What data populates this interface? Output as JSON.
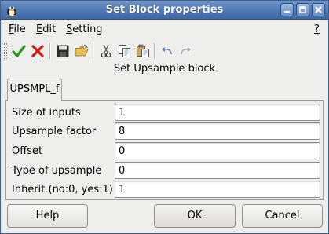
{
  "window": {
    "title": "Set Block properties",
    "controls": [
      "minimize-icon",
      "maximize-icon",
      "close-icon"
    ]
  },
  "menubar": {
    "file": {
      "underline": "F",
      "rest": "ile"
    },
    "edit": {
      "underline": "E",
      "rest": "dit"
    },
    "setting": {
      "underline": "S",
      "rest": "etting"
    },
    "help": "?"
  },
  "toolbar": {
    "icons": [
      "checkmark-icon",
      "cross-icon",
      "save-icon",
      "open-folder-icon",
      "cut-icon",
      "copy-icon",
      "paste-icon",
      "undo-icon",
      "redo-icon"
    ]
  },
  "header": "Set Upsample block",
  "tabs": [
    {
      "label": "UPSMPL_f",
      "active": true
    }
  ],
  "fields": [
    {
      "label": "Size of inputs",
      "value": "1"
    },
    {
      "label": "Upsample factor",
      "value": "8"
    },
    {
      "label": "Offset",
      "value": "0"
    },
    {
      "label": "Type of upsample",
      "value": "0"
    },
    {
      "label": "Inherit (no:0, yes:1)",
      "value": "1"
    }
  ],
  "buttons": {
    "help": "Help",
    "ok": "OK",
    "cancel": "Cancel"
  },
  "colors": {
    "titlebar": "#4f78b5",
    "window_bg": "#eeeeec",
    "check": "#2a9a1e",
    "cross": "#d01a12"
  }
}
